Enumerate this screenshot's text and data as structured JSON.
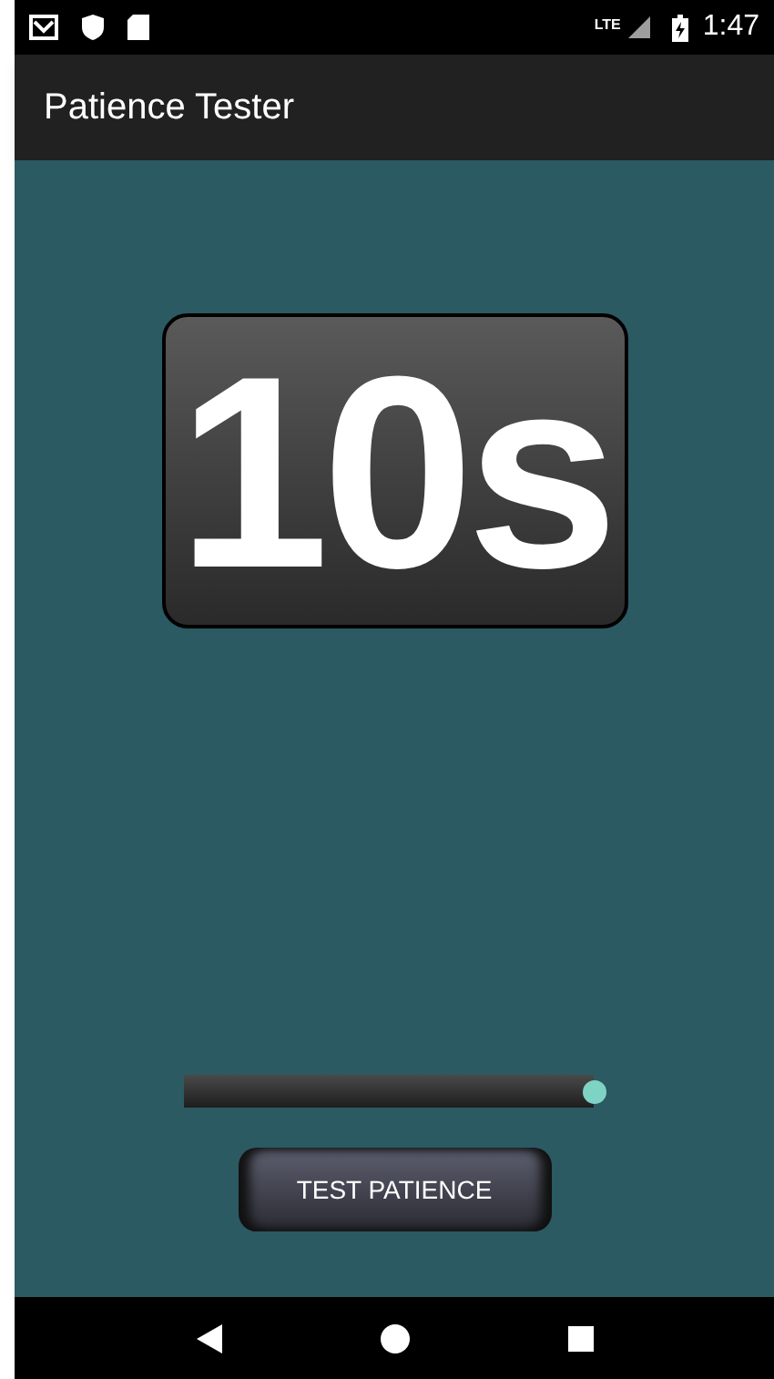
{
  "status_bar": {
    "network": "LTE",
    "time": "1:47"
  },
  "app_bar": {
    "title": "Patience Tester"
  },
  "timer": {
    "display": "10s"
  },
  "slider": {
    "level": 1.0
  },
  "button": {
    "label": "TEST PATIENCE"
  }
}
